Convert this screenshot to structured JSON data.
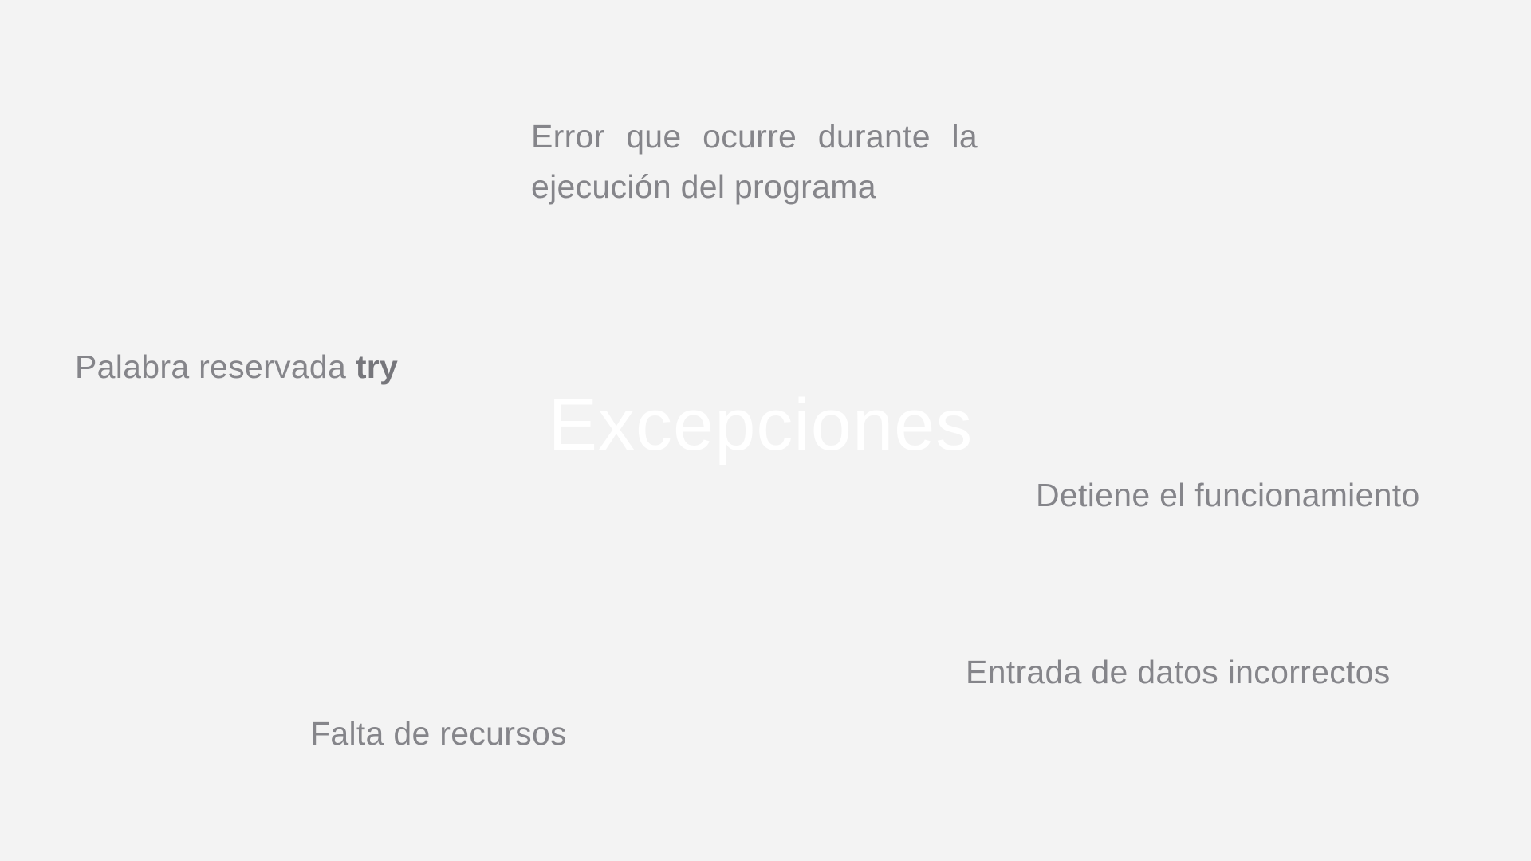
{
  "slide": {
    "title": "Excepciones",
    "notes": {
      "error_line1": "Error que ocurre durante la",
      "error_line2": "ejecución del programa",
      "try_prefix": "Palabra reservada ",
      "try_keyword": "try",
      "detiene": "Detiene el funcionamiento",
      "entrada": "Entrada de datos incorrectos",
      "falta": "Falta de recursos"
    }
  },
  "colors": {
    "background": "#f3f3f3",
    "text": "#85858a",
    "title": "#ffffff"
  }
}
